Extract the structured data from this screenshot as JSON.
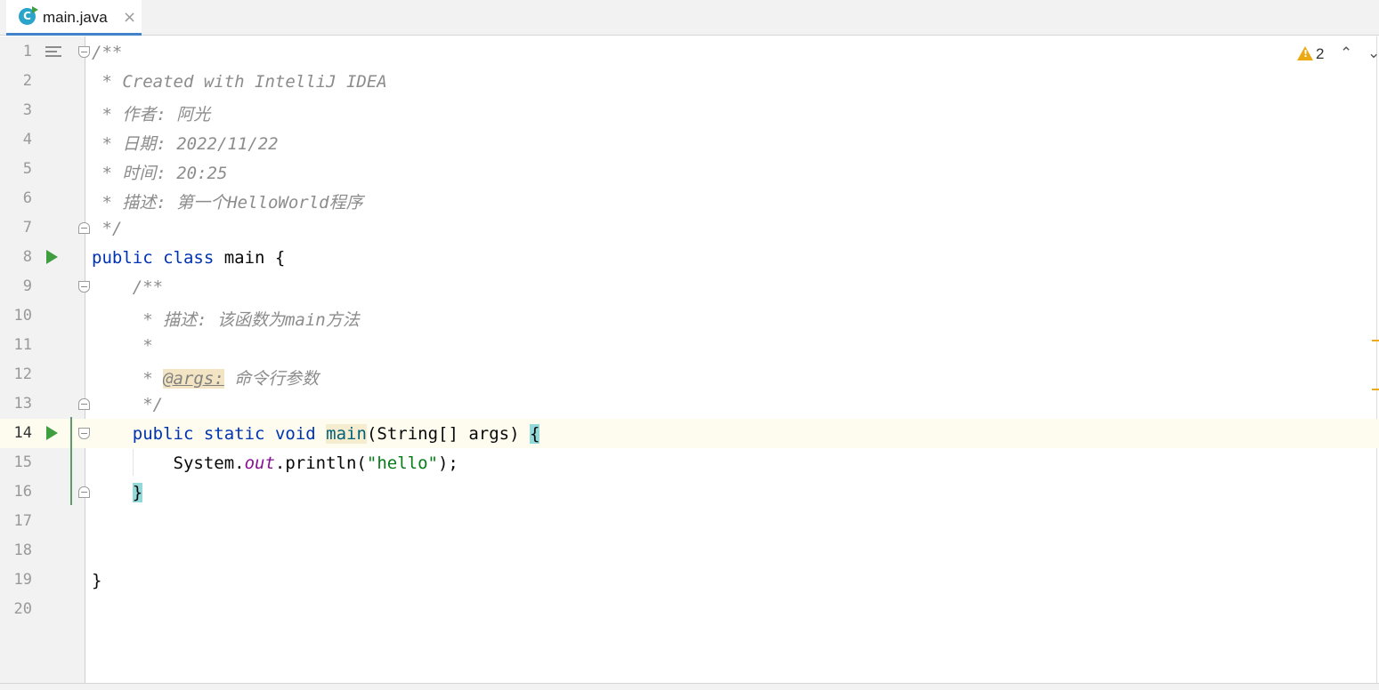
{
  "tab": {
    "file_icon_letter": "C",
    "label": "main.java",
    "close": "×"
  },
  "inspection": {
    "warning_count": "2",
    "up": "⌃",
    "down": "⌄"
  },
  "lines": [
    {
      "n": "1",
      "t1": "/**"
    },
    {
      "n": "2",
      "t1": " * Created with IntelliJ IDEA"
    },
    {
      "n": "3",
      "t1": " * 作者: 阿光"
    },
    {
      "n": "4",
      "t1": " * 日期: 2022/11/22"
    },
    {
      "n": "5",
      "t1": " * 时间: 20:25"
    },
    {
      "n": "6",
      "t1": " * 描述: 第一个HelloWorld程序"
    },
    {
      "n": "7",
      "t1": " */"
    },
    {
      "n": "8",
      "k1": "public",
      "k2": "class",
      "t1": " main {"
    },
    {
      "n": "9",
      "t1": "    /**"
    },
    {
      "n": "10",
      "t1": "     * 描述: 该函数为main方法"
    },
    {
      "n": "11",
      "t1": "     *"
    },
    {
      "n": "12",
      "t1": "     * ",
      "tag": "@args:",
      "t2": " 命令行参数"
    },
    {
      "n": "13",
      "t1": "     */"
    },
    {
      "n": "14",
      "t0": "    ",
      "k1": "public",
      "k2": "static",
      "k3": "void",
      "m": "main",
      "t1": "(String[] args) ",
      "b": "{"
    },
    {
      "n": "15",
      "t0": "        System.",
      "f": "out",
      "t1": ".println(",
      "s": "\"hello\"",
      "t2": ");"
    },
    {
      "n": "16",
      "t0": "    ",
      "b": "}"
    },
    {
      "n": "17"
    },
    {
      "n": "18"
    },
    {
      "n": "19",
      "t1": "}"
    },
    {
      "n": "20"
    }
  ]
}
